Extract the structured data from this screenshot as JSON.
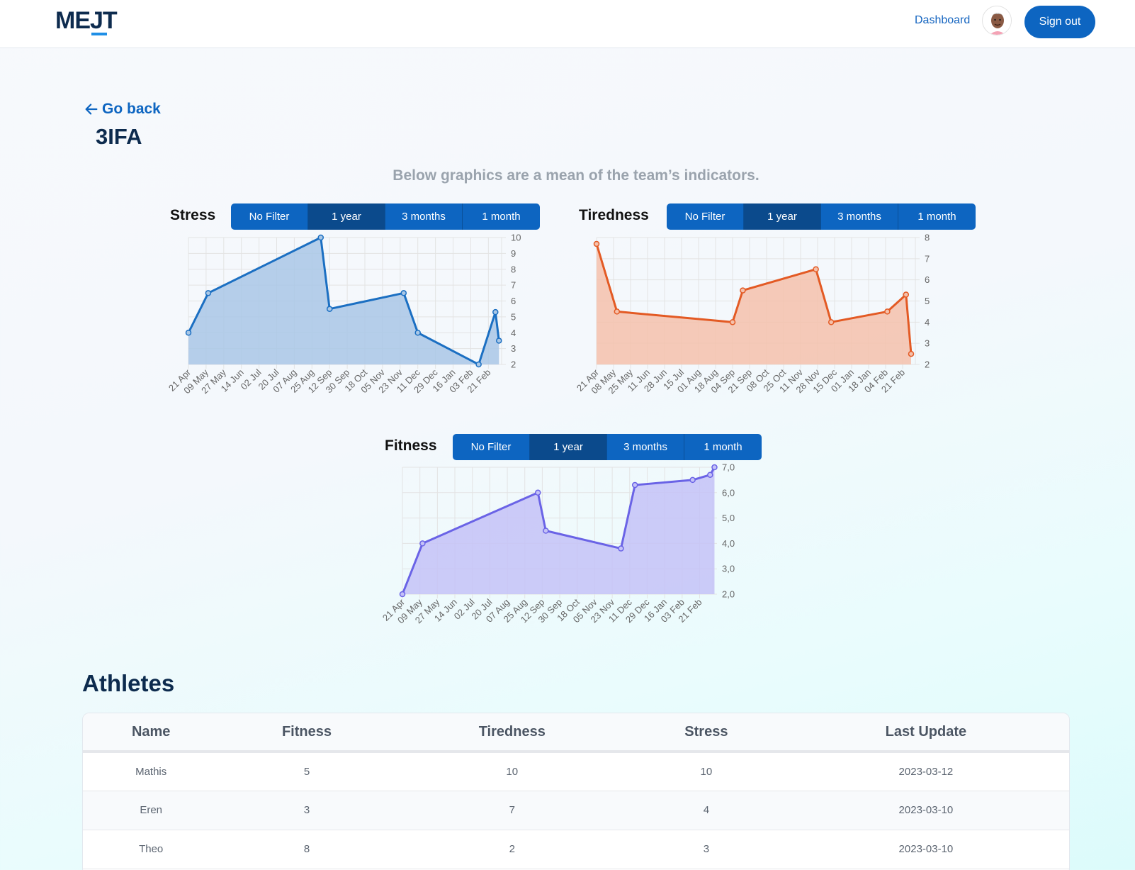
{
  "header": {
    "logo_text": "MEJT",
    "nav_dashboard": "Dashboard",
    "avatar_icon": "user-avatar-icon",
    "signout_label": "Sign out"
  },
  "page": {
    "back_label": "Go back",
    "team_name": "3IFA",
    "subtitle": "Below graphics are a mean of the team’s indicators."
  },
  "filters": [
    "No Filter",
    "1 year",
    "3 months",
    "1 month"
  ],
  "active_filter": "1 year",
  "colors": {
    "primary": "#0d65c1",
    "primary_active": "#0b4a8c",
    "stress_line": "#1b6fc2",
    "stress_fill": "#a9c7e6",
    "tiredness_line": "#e35a24",
    "tiredness_fill": "#f5c1ab",
    "fitness_line": "#6a63e6",
    "fitness_fill": "#c4c2f7"
  },
  "chart_data": [
    {
      "type": "area",
      "title": "Stress",
      "x_ticks": [
        "21 Apr",
        "09 May",
        "27 May",
        "14 Jun",
        "02 Jul",
        "20 Jul",
        "07 Aug",
        "25 Aug",
        "12 Sep",
        "30 Sep",
        "18 Oct",
        "05 Nov",
        "23 Nov",
        "11 Dec",
        "29 Dec",
        "16 Jan",
        "03 Feb",
        "21 Feb"
      ],
      "y_ticks": [
        "2",
        "3",
        "4",
        "5",
        "6",
        "7",
        "8",
        "9",
        "10"
      ],
      "ylim": [
        2,
        10
      ],
      "grid": true,
      "points": [
        {
          "x": 0.0,
          "y": 4.0
        },
        {
          "x": 1.12,
          "y": 6.5
        },
        {
          "x": 7.5,
          "y": 10.0
        },
        {
          "x": 8.0,
          "y": 5.5
        },
        {
          "x": 12.2,
          "y": 6.5
        },
        {
          "x": 13.0,
          "y": 4.0
        },
        {
          "x": 16.45,
          "y": 2.0
        },
        {
          "x": 17.4,
          "y": 5.3
        },
        {
          "x": 17.6,
          "y": 3.5
        }
      ]
    },
    {
      "type": "area",
      "title": "Tiredness",
      "x_ticks": [
        "21 Apr",
        "08 May",
        "25 May",
        "11 Jun",
        "28 Jun",
        "15 Jul",
        "01 Aug",
        "18 Aug",
        "04 Sep",
        "21 Sep",
        "08 Oct",
        "25 Oct",
        "11 Nov",
        "28 Nov",
        "15 Dec",
        "01 Jan",
        "18 Jan",
        "04 Feb",
        "21 Feb"
      ],
      "y_ticks": [
        "2",
        "3",
        "4",
        "5",
        "6",
        "7",
        "8"
      ],
      "ylim": [
        2,
        8
      ],
      "grid": true,
      "points": [
        {
          "x": 0.0,
          "y": 7.7
        },
        {
          "x": 1.2,
          "y": 4.5
        },
        {
          "x": 8.0,
          "y": 4.0
        },
        {
          "x": 8.6,
          "y": 5.5
        },
        {
          "x": 12.9,
          "y": 6.5
        },
        {
          "x": 13.8,
          "y": 4.0
        },
        {
          "x": 17.1,
          "y": 4.5
        },
        {
          "x": 18.2,
          "y": 5.3
        },
        {
          "x": 18.5,
          "y": 2.5
        }
      ]
    },
    {
      "type": "area",
      "title": "Fitness",
      "x_ticks": [
        "21 Apr",
        "09 May",
        "27 May",
        "14 Jun",
        "02 Jul",
        "20 Jul",
        "07 Aug",
        "25 Aug",
        "12 Sep",
        "30 Sep",
        "18 Oct",
        "05 Nov",
        "23 Nov",
        "11 Dec",
        "29 Dec",
        "16 Jan",
        "03 Feb",
        "21 Feb"
      ],
      "y_ticks": [
        "2,0",
        "3,0",
        "4,0",
        "5,0",
        "6,0",
        "7,0"
      ],
      "ylim": [
        2,
        7
      ],
      "grid": true,
      "points": [
        {
          "x": 0.0,
          "y": 2.0
        },
        {
          "x": 1.15,
          "y": 4.0
        },
        {
          "x": 7.75,
          "y": 6.0
        },
        {
          "x": 8.2,
          "y": 4.5
        },
        {
          "x": 12.5,
          "y": 3.8
        },
        {
          "x": 13.3,
          "y": 6.3
        },
        {
          "x": 16.6,
          "y": 6.5
        },
        {
          "x": 17.6,
          "y": 6.7
        },
        {
          "x": 17.85,
          "y": 7.0
        }
      ]
    }
  ],
  "athletes": {
    "title": "Athletes",
    "columns": [
      "Name",
      "Fitness",
      "Tiredness",
      "Stress",
      "Last Update"
    ],
    "rows": [
      [
        "Mathis",
        "5",
        "10",
        "10",
        "2023-03-12"
      ],
      [
        "Eren",
        "3",
        "7",
        "4",
        "2023-03-10"
      ],
      [
        "Theo",
        "8",
        "2",
        "3",
        "2023-03-10"
      ]
    ]
  }
}
